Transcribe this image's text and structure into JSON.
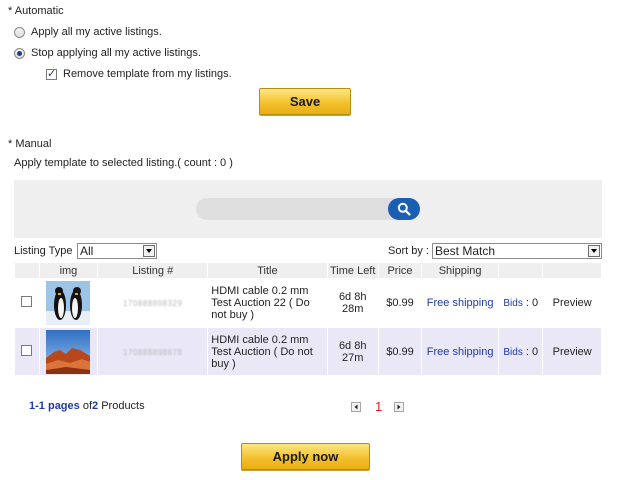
{
  "automatic": {
    "heading": "* Automatic",
    "option_apply": "Apply all my active listings.",
    "option_stop": "Stop applying all my active listings.",
    "remove_template": "Remove template from my listings.",
    "save_label": "Save"
  },
  "manual": {
    "heading": "* Manual",
    "apply_text": "Apply template to selected listing.( count : 0 )"
  },
  "filters": {
    "listing_type_label": "Listing Type",
    "listing_type_value": "All",
    "sort_label": "Sort by :",
    "sort_value": "Best Match"
  },
  "table": {
    "headers": [
      "img",
      "Listing #",
      "Title",
      "Time Left",
      "Price",
      "Shipping",
      "",
      ""
    ],
    "rows": [
      {
        "listing_no": "170888898329",
        "title_1": "HDMI cable 0.2 mm",
        "title_2": "Test Auction 22 ( Do",
        "title_3": "not buy )",
        "time_1": "6d 8h",
        "time_2": "28m",
        "price": "$0.99",
        "shipping": "Free shipping",
        "bids_label": "Bids",
        "bids_count": ": 0",
        "preview": "Preview"
      },
      {
        "listing_no": "170888898678",
        "title_1": "HDMI cable 0.2 mm",
        "title_2": "Test Auction ( Do not",
        "title_3": "buy )",
        "time_1": "6d 8h",
        "time_2": "27m",
        "price": "$0.99",
        "shipping": "Free shipping",
        "bids_label": "Bids",
        "bids_count": ": 0",
        "preview": "Preview"
      }
    ]
  },
  "pager": {
    "range": "1-1",
    "pages_word": "pages",
    "of_word": "of",
    "count": "2",
    "products_word": "Products",
    "current_page": "1"
  },
  "apply_now_label": "Apply now",
  "colors": {
    "accent_blue": "#1f3aa8",
    "gold": "#f3c22f",
    "row_alt": "#eae8f7",
    "page_red": "#d42020"
  }
}
